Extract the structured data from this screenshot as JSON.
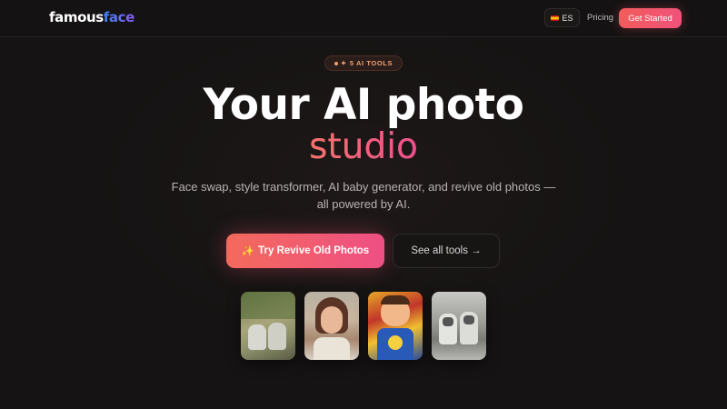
{
  "header": {
    "logo_main": "famous",
    "logo_accent": "face",
    "lang_label": "ES",
    "pricing_label": "Pricing",
    "cta_label": "Get Started"
  },
  "hero": {
    "badge": "5 AI TOOLS",
    "title_line1": "Your AI photo",
    "title_line2": "studio",
    "subtitle_line1": "Face swap, style transformer, AI baby generator, and revive old photos —",
    "subtitle_line2": "all powered by AI.",
    "primary_cta": "Try Revive Old Photos",
    "primary_cta_icon": "✨",
    "secondary_cta": "See all tools →"
  },
  "thumbnails": [
    {
      "name": "vintage-dogs-photo"
    },
    {
      "name": "cartoon-woman-portrait"
    },
    {
      "name": "comic-baby-illustration"
    },
    {
      "name": "restored-dogs-photo"
    }
  ],
  "colors": {
    "background": "#151313",
    "accent_start": "#f36a5c",
    "accent_end": "#ef4f84"
  }
}
